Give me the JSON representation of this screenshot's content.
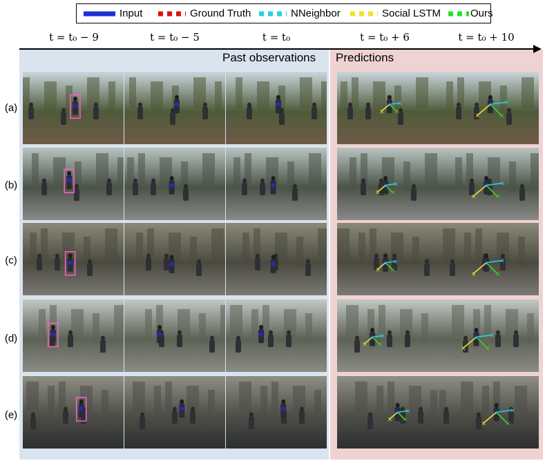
{
  "legend": {
    "items": [
      {
        "label": "Input",
        "color": "#1f2fd6",
        "style": "solid"
      },
      {
        "label": "Ground Truth",
        "color": "#e01010",
        "style": "dashed"
      },
      {
        "label": "NNeighbor",
        "color": "#2ad0e0",
        "style": "dashed"
      },
      {
        "label": "Social LSTM",
        "color": "#f2e22a",
        "style": "dashed"
      },
      {
        "label": "Ours",
        "color": "#2adf2a",
        "style": "dashed"
      }
    ]
  },
  "timeline": {
    "labels": [
      "t = t₀ − 9",
      "t = t₀ − 5",
      "t = t₀",
      "t = t₀ + 6",
      "t = t₀ + 10"
    ]
  },
  "panels": {
    "past_title": "Past observations",
    "pred_title": "Predictions"
  },
  "rows": [
    {
      "label": "(a)",
      "scene": "street"
    },
    {
      "label": "(b)",
      "scene": "sidewalk"
    },
    {
      "label": "(c)",
      "scene": "arcade"
    },
    {
      "label": "(d)",
      "scene": "crowd"
    },
    {
      "label": "(e)",
      "scene": "tunnel"
    }
  ],
  "colors": {
    "past_panel": "#d9e4ef",
    "pred_panel": "#efd3d2",
    "target_box": "#ff5fc8"
  }
}
